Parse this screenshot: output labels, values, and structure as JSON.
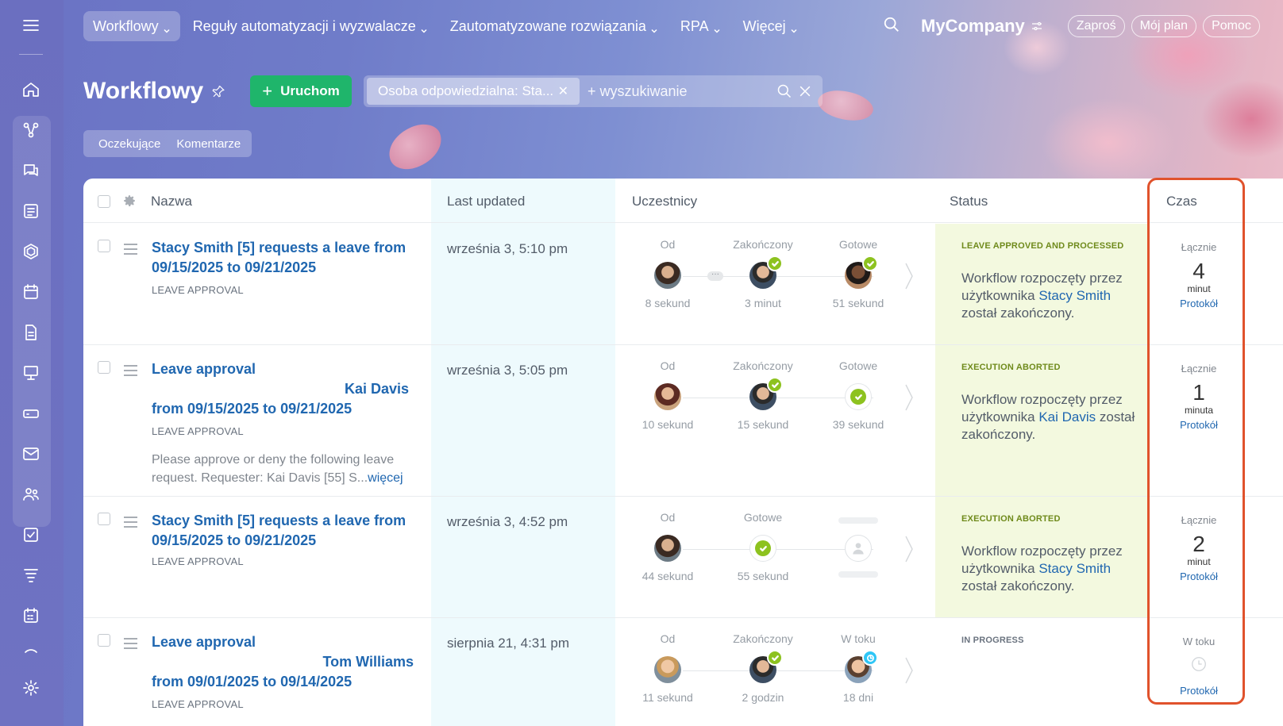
{
  "nav": {
    "items": [
      {
        "label": "Workflowy",
        "active": true
      },
      {
        "label": "Reguły automatyzacji i wyzwalacze"
      },
      {
        "label": "Zautomatyzowane rozwiązania"
      },
      {
        "label": "RPA"
      },
      {
        "label": "Więcej"
      }
    ],
    "company": "MyCompany",
    "invite": "Zaproś",
    "plan": "Mój plan",
    "help": "Pomoc"
  },
  "page": {
    "title": "Workflowy",
    "run_button": "Uruchom",
    "filter_chip": "Osoba odpowiedzialna: Sta...",
    "search_placeholder": "+ wyszukiwanie",
    "tabs": [
      "Oczekujące",
      "Komentarze"
    ]
  },
  "table": {
    "columns": [
      "Nazwa",
      "Last updated",
      "Uczestnicy",
      "Status",
      "Czas"
    ],
    "rows": [
      {
        "title_line1": "Stacy Smith [5] requests a leave from",
        "title_line2": "09/15/2025 to 09/21/2025",
        "type": "LEAVE APPROVAL",
        "updated": "września 3, 5:10 pm",
        "steps": [
          {
            "label": "Od",
            "sub": "8 sekund"
          },
          {
            "label": "Zakończony",
            "sub": "3 minut"
          },
          {
            "label": "Gotowe",
            "sub": "51 sekund"
          }
        ],
        "status_label": "LEAVE APPROVED AND PROCESSED",
        "status_text_a": "Workflow rozpoczęty przez użytkownika ",
        "status_user": "Stacy Smith",
        "status_text_b": " został zakończony.",
        "time_label": "Łącznie",
        "time_value": "4",
        "time_unit": "minut",
        "log": "Protokół"
      },
      {
        "title_line1": "Leave approval",
        "title_line2": "Kai Davis",
        "title_line3": "from 09/15/2025 to 09/21/2025",
        "type": "LEAVE APPROVAL",
        "desc": "Please approve or deny the following leave request.  Requester: Kai Davis [55] S...",
        "more": "więcej",
        "updated": "września 3, 5:05 pm",
        "steps": [
          {
            "label": "Od",
            "sub": "10 sekund"
          },
          {
            "label": "Zakończony",
            "sub": "15 sekund"
          },
          {
            "label": "Gotowe",
            "sub": "39 sekund"
          }
        ],
        "status_label": "EXECUTION ABORTED",
        "status_text_a": "Workflow rozpoczęty przez użytkownika ",
        "status_user": "Kai Davis",
        "status_text_b": " został zakończony.",
        "time_label": "Łącznie",
        "time_value": "1",
        "time_unit": "minuta",
        "log": "Protokół"
      },
      {
        "title_line1": "Stacy Smith [5] requests a leave from",
        "title_line2": "09/15/2025 to 09/21/2025",
        "type": "LEAVE APPROVAL",
        "updated": "września 3, 4:52 pm",
        "steps": [
          {
            "label": "Od",
            "sub": "44 sekund"
          },
          {
            "label": "Gotowe",
            "sub": "55 sekund"
          }
        ],
        "status_label": "EXECUTION ABORTED",
        "status_text_a": "Workflow rozpoczęty przez użytkownika ",
        "status_user": "Stacy Smith",
        "status_text_b": " został zakończony.",
        "time_label": "Łącznie",
        "time_value": "2",
        "time_unit": "minut",
        "log": "Protokół"
      },
      {
        "title_line1": "Leave approval",
        "title_line2": "Tom Williams",
        "title_line3": "from 09/01/2025 to 09/14/2025",
        "type": "LEAVE APPROVAL",
        "updated": "sierpnia 21, 4:31 pm",
        "steps": [
          {
            "label": "Od",
            "sub": "11 sekund"
          },
          {
            "label": "Zakończony",
            "sub": "2 godzin"
          },
          {
            "label": "W toku",
            "sub": "18 dni"
          }
        ],
        "status_label": "IN PROGRESS",
        "time_label": "W toku",
        "log": "Protokół"
      }
    ]
  },
  "colors": {
    "accent_green": "#1fb56b",
    "link_blue": "#2067b0",
    "highlight": "#e0522c",
    "status_green": "#8dc21f"
  }
}
